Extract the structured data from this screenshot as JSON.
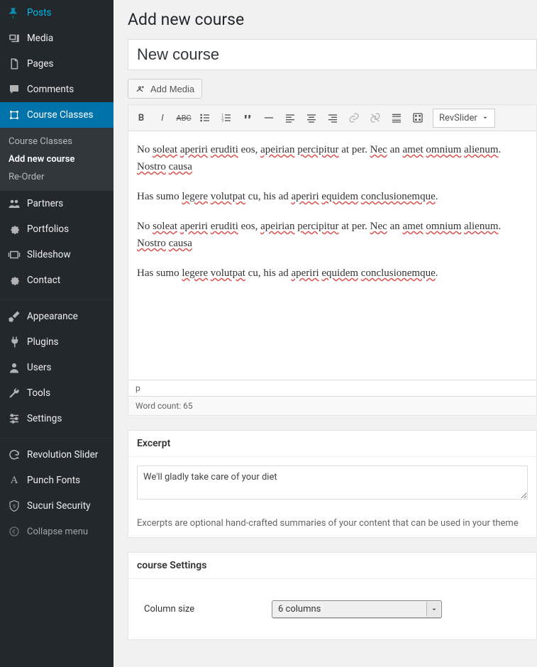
{
  "page": {
    "title": "Add new course"
  },
  "sidebar": {
    "items": [
      {
        "label": "Posts",
        "icon": "pin"
      },
      {
        "label": "Media",
        "icon": "media"
      },
      {
        "label": "Pages",
        "icon": "page"
      },
      {
        "label": "Comments",
        "icon": "comment"
      },
      {
        "label": "Course Classes",
        "icon": "course",
        "active": true,
        "submenu": [
          {
            "label": "Course Classes"
          },
          {
            "label": "Add new course",
            "current": true
          },
          {
            "label": "Re-Order"
          }
        ]
      },
      {
        "label": "Partners",
        "icon": "users"
      },
      {
        "label": "Portfolios",
        "icon": "gear"
      },
      {
        "label": "Slideshow",
        "icon": "slides"
      },
      {
        "label": "Contact",
        "icon": "gear"
      },
      {
        "sep": true
      },
      {
        "label": "Appearance",
        "icon": "brush"
      },
      {
        "label": "Plugins",
        "icon": "plug"
      },
      {
        "label": "Users",
        "icon": "user"
      },
      {
        "label": "Tools",
        "icon": "wrench"
      },
      {
        "label": "Settings",
        "icon": "sliders"
      },
      {
        "sep": true
      },
      {
        "label": "Revolution Slider",
        "icon": "refresh"
      },
      {
        "label": "Punch Fonts",
        "icon": "font"
      },
      {
        "label": "Sucuri Security",
        "icon": "shield"
      }
    ],
    "collapse": "Collapse menu"
  },
  "title_input": {
    "value": "New course"
  },
  "media_btn": "Add Media",
  "toolbar": {
    "dropdown": "RevSlider"
  },
  "editor": {
    "p1a": "No ",
    "p1b": "soleat",
    "p1c": " ",
    "p1d": "aperiri",
    "p1e": " ",
    "p1f": "eruditi",
    "p1g": " eos, ",
    "p1h": "apeirian",
    "p1i": " ",
    "p1j": "percipitur",
    "p1k": " at per. ",
    "p1l": "Nec",
    "p1m": " an ",
    "p1n": "amet",
    "p1o": " ",
    "p1p": "omnium",
    "p1q": " ",
    "p1r": "alienum",
    "p1s": ". ",
    "p1t": "Nostro",
    "p1u": " ",
    "p1v": "causa",
    "p2a": "Has sumo ",
    "p2b": "legere",
    "p2c": " ",
    "p2d": "volutpat",
    "p2e": " cu, his ad ",
    "p2f": "aperiri",
    "p2g": " ",
    "p2h": "equidem",
    "p2i": " ",
    "p2j": "conclusionemque",
    "p2k": ".",
    "path": "p",
    "wordcount": "Word count: 65"
  },
  "excerpt": {
    "heading": "Excerpt",
    "value": "We'll gladly take care of your diet",
    "help": "Excerpts are optional hand-crafted summaries of your content that can be used in your theme"
  },
  "settings": {
    "heading": "course Settings",
    "column_label": "Column size",
    "column_value": "6 columns"
  }
}
